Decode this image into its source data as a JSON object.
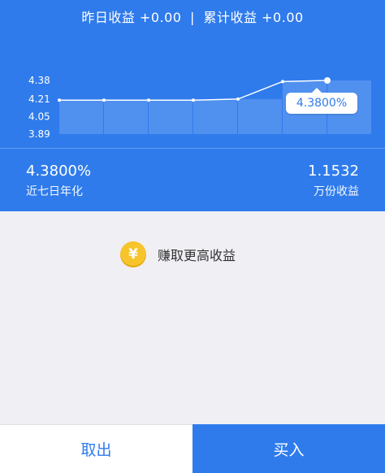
{
  "summary": {
    "yesterday_label": "昨日收益",
    "yesterday_value": "+0.00",
    "separator": "|",
    "total_label": "累计收益",
    "total_value": "+0.00"
  },
  "chart_data": {
    "type": "line",
    "yticks": [
      "4.38",
      "4.21",
      "4.05",
      "3.89"
    ],
    "ylim": [
      3.89,
      4.38
    ],
    "x": [
      1,
      2,
      3,
      4,
      5,
      6,
      7
    ],
    "values": [
      4.2,
      4.2,
      4.2,
      4.2,
      4.21,
      4.37,
      4.38
    ],
    "highlight_label": "4.3800%",
    "grid": false
  },
  "stats": {
    "annual_value": "4.3800%",
    "annual_label": "近七日年化",
    "per10k_value": "1.1532",
    "per10k_label": "万份收益"
  },
  "promo": {
    "coin_symbol": "¥",
    "text": "赚取更高收益"
  },
  "buttons": {
    "withdraw": "取出",
    "buy": "买入"
  },
  "colors": {
    "brand_blue": "#2f7bec",
    "background": "#efeff4",
    "coin": "#f7c42b"
  }
}
